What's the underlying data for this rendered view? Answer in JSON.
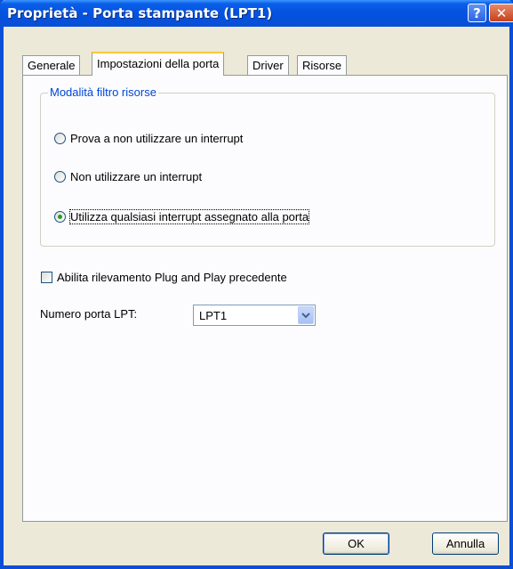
{
  "window": {
    "title": "Proprietà - Porta stampante (LPT1)",
    "help_glyph": "?",
    "close_glyph": "✕"
  },
  "tabs": [
    {
      "label": "Generale",
      "active": false
    },
    {
      "label": "Impostazioni della porta",
      "active": true
    },
    {
      "label": "Driver",
      "active": false
    },
    {
      "label": "Risorse",
      "active": false
    }
  ],
  "group": {
    "legend": "Modalità filtro risorse",
    "options": [
      {
        "label": "Prova a non utilizzare un interrupt",
        "selected": false
      },
      {
        "label": "Non utilizzare un interrupt",
        "selected": false
      },
      {
        "label": "Utilizza qualsiasi interrupt assegnato alla porta",
        "selected": true
      }
    ]
  },
  "pnp": {
    "label": "Abilita rilevamento Plug and Play precedente",
    "checked": false
  },
  "lpt": {
    "label": "Numero porta LPT:",
    "value": "LPT1"
  },
  "buttons": {
    "ok": "OK",
    "cancel": "Annulla"
  },
  "colors": {
    "title_bar": "#0a4fd6",
    "group_legend": "#0046d5",
    "radio_dot": "#21a121"
  }
}
